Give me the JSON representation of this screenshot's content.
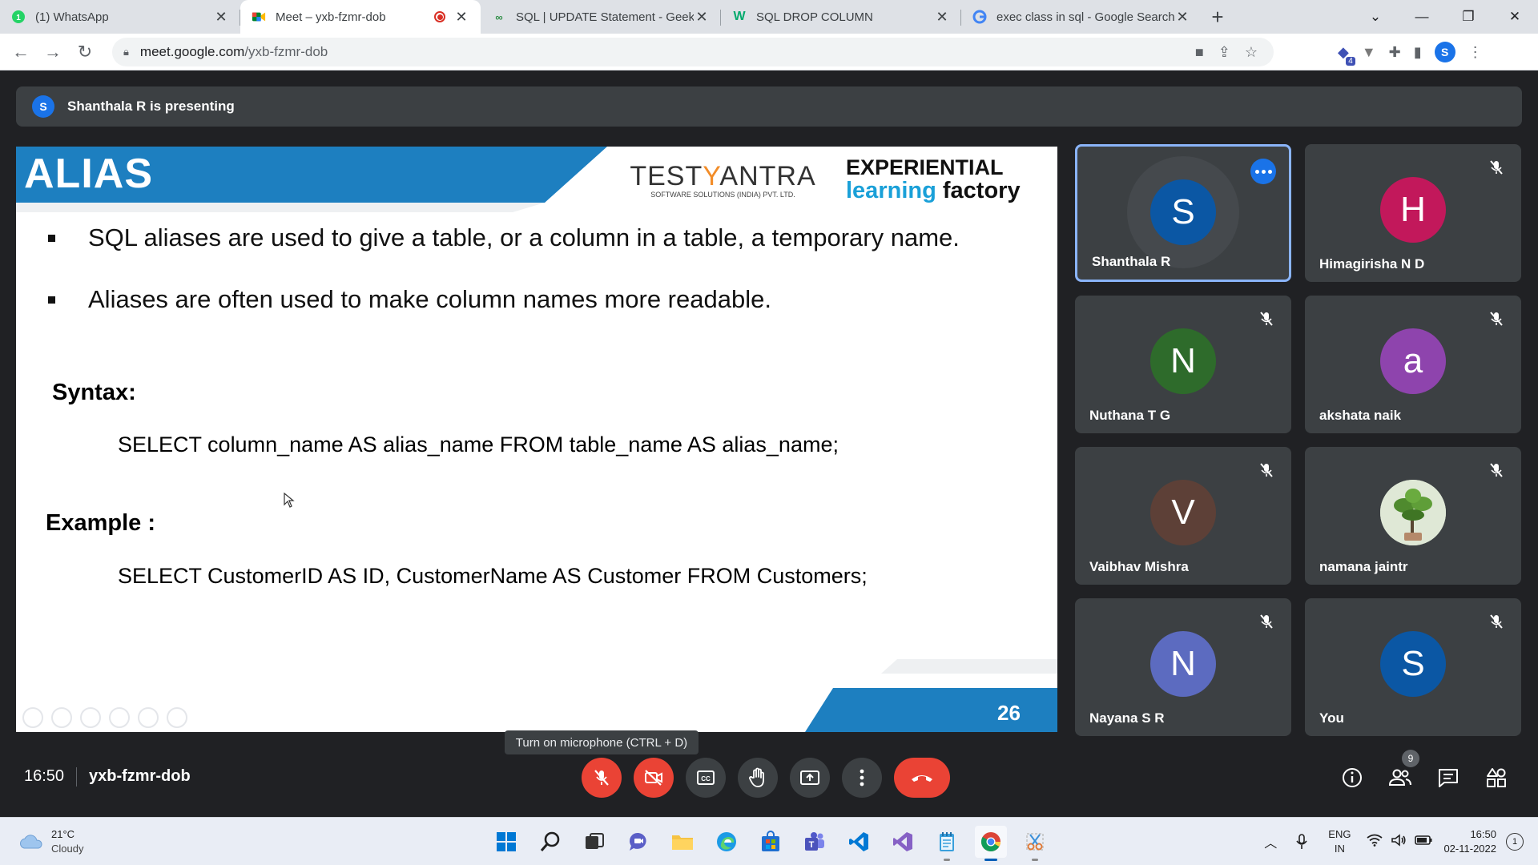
{
  "browser": {
    "tabs": [
      {
        "title": "(1) WhatsApp",
        "icon": "whatsapp-icon",
        "active": false
      },
      {
        "title": "Meet – yxb-fzmr-dob",
        "icon": "meet-icon",
        "active": true,
        "recording": true
      },
      {
        "title": "SQL | UPDATE Statement - Geeks",
        "icon": "geeksforgeeks-icon",
        "active": false
      },
      {
        "title": "SQL DROP COLUMN",
        "icon": "w3schools-icon",
        "active": false
      },
      {
        "title": "exec class in sql - Google Search",
        "icon": "google-icon",
        "active": false
      }
    ],
    "url_host": "meet.google.com",
    "url_path": "/yxb-fzmr-dob",
    "profile_initial": "S",
    "extension_badge": "4"
  },
  "meet": {
    "presenter_initial": "S",
    "presenting_text": "Shanthala R is presenting",
    "time": "16:50",
    "meeting_code": "yxb-fzmr-dob",
    "tooltip": "Turn on microphone (CTRL + D)",
    "participant_count": "9",
    "participants": [
      {
        "name": "Shanthala R",
        "initial": "S",
        "color": "#0b57a4",
        "muted": false,
        "speaking": true
      },
      {
        "name": "Himagirisha N D",
        "initial": "H",
        "color": "#c2185b",
        "muted": true
      },
      {
        "name": "Nuthana T G",
        "initial": "N",
        "color": "#2e6b2b",
        "muted": true
      },
      {
        "name": "akshata naik",
        "initial": "a",
        "color": "#8e44ad",
        "muted": true
      },
      {
        "name": "Vaibhav Mishra",
        "initial": "V",
        "color": "#5d4037",
        "muted": true
      },
      {
        "name": "namana jaintr",
        "initial": "",
        "color": "#6b8e4e",
        "muted": true,
        "photo": true
      },
      {
        "name": "Nayana S R",
        "initial": "N",
        "color": "#5c6bc0",
        "muted": true
      },
      {
        "name": "You",
        "initial": "S",
        "color": "#0b57a4",
        "muted": true
      }
    ]
  },
  "slide": {
    "title": "ALIAS",
    "brand_left_a": "TEST",
    "brand_left_b": "Y",
    "brand_left_c": "ANTRA",
    "brand_sub": "SOFTWARE SOLUTIONS (INDIA) PVT. LTD.",
    "brand_right_1": "EXPERIENTIAL",
    "brand_right_2a": "learning",
    "brand_right_2b": "factory",
    "bullets": [
      "SQL aliases are used to give a table, or a column in a table, a temporary name.",
      "Aliases are often used to make column names more readable."
    ],
    "syntax_label": "Syntax:",
    "syntax_code": "SELECT column_name AS alias_name FROM table_name AS alias_name;",
    "example_label": "Example :",
    "example_code": "SELECT CustomerID AS ID, CustomerName AS Customer FROM Customers;",
    "page_number": "26"
  },
  "taskbar": {
    "temperature": "21°C",
    "condition": "Cloudy",
    "lang_1": "ENG",
    "lang_2": "IN",
    "clock_time": "16:50",
    "clock_date": "02-11-2022",
    "notification_count": "1"
  }
}
